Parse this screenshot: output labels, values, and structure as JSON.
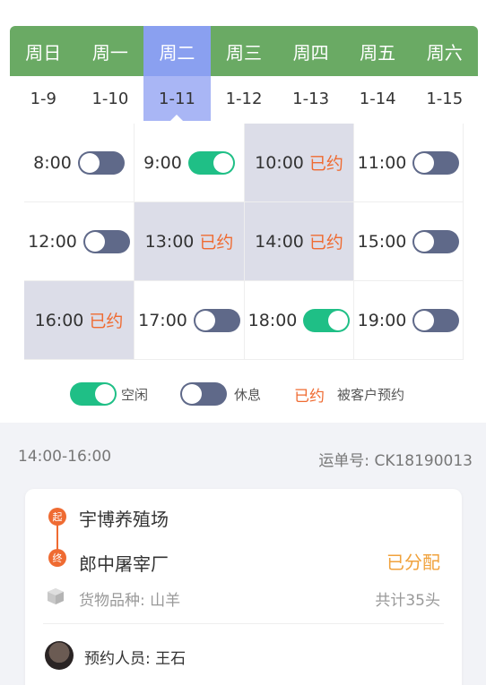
{
  "week": {
    "days": [
      "周日",
      "周一",
      "周二",
      "周三",
      "周四",
      "周五",
      "周六"
    ],
    "dates": [
      "1-9",
      "1-10",
      "1-11",
      "1-12",
      "1-13",
      "1-14",
      "1-15"
    ],
    "selected_index": 2
  },
  "slots": [
    {
      "time": "8:00",
      "state": "rest"
    },
    {
      "time": "9:00",
      "state": "free"
    },
    {
      "time": "10:00",
      "state": "booked",
      "label": "已约"
    },
    {
      "time": "11:00",
      "state": "rest"
    },
    {
      "time": "12:00",
      "state": "rest"
    },
    {
      "time": "13:00",
      "state": "booked",
      "label": "已约"
    },
    {
      "time": "14:00",
      "state": "booked",
      "label": "已约"
    },
    {
      "time": "15:00",
      "state": "rest"
    },
    {
      "time": "16:00",
      "state": "booked",
      "label": "已约"
    },
    {
      "time": "17:00",
      "state": "rest"
    },
    {
      "time": "18:00",
      "state": "free"
    },
    {
      "time": "19:00",
      "state": "rest"
    }
  ],
  "legend": {
    "free": "空闲",
    "rest": "休息",
    "booked_word": "已约",
    "booked_desc": "被客户预约"
  },
  "order": {
    "time_range": "14:00-16:00",
    "waybill": "运单号: CK18190013",
    "start_badge": "起",
    "end_badge": "终",
    "origin": "宇博养殖场",
    "destination": "郎中屠宰厂",
    "status": "已分配",
    "cargo": "货物品种: 山羊",
    "count": "共计35头",
    "booker": "预约人员: 王石"
  },
  "colors": {
    "header_green": "#6aaa64",
    "selected_blue": "#8aa0f0",
    "toggle_on": "#1fbf86",
    "toggle_off": "#5f6989",
    "booked_orange": "#ef6b32",
    "status_orange": "#f0a23c"
  }
}
